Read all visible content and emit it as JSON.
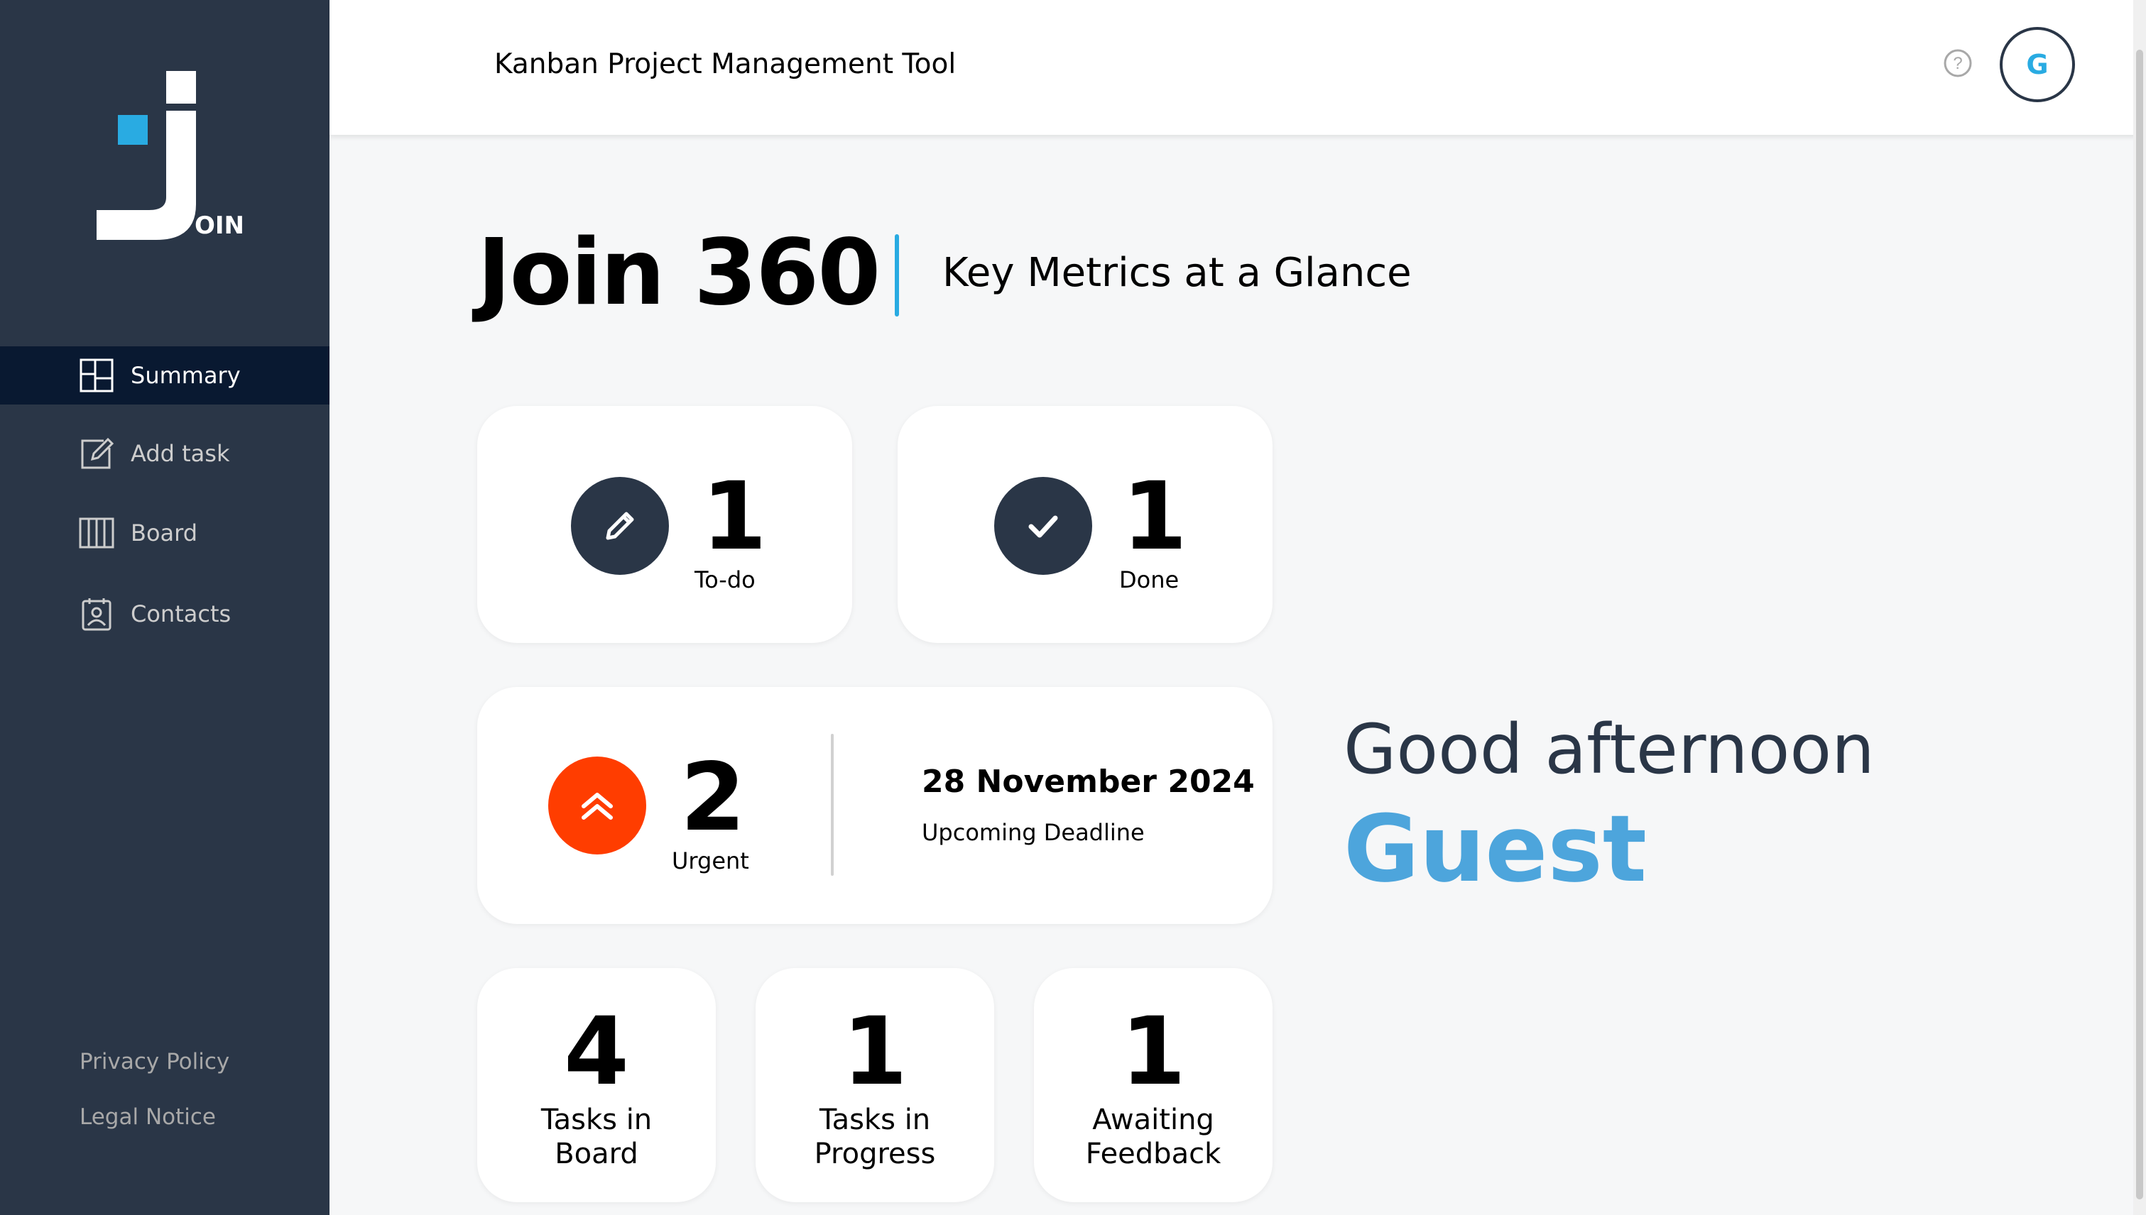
{
  "brand": {
    "logo_text": "OIN"
  },
  "sidebar": {
    "items": [
      {
        "label": "Summary",
        "icon": "summary-icon",
        "active": true
      },
      {
        "label": "Add task",
        "icon": "add-task-icon",
        "active": false
      },
      {
        "label": "Board",
        "icon": "board-icon",
        "active": false
      },
      {
        "label": "Contacts",
        "icon": "contacts-icon",
        "active": false
      }
    ],
    "footer": {
      "privacy": "Privacy Policy",
      "legal": "Legal Notice"
    }
  },
  "header": {
    "title": "Kanban Project Management Tool",
    "help_icon": "help-icon",
    "avatar_initial": "G"
  },
  "page": {
    "title": "Join 360",
    "subtitle": "Key Metrics at a Glance"
  },
  "metrics": {
    "todo": {
      "count": "1",
      "label": "To-do",
      "icon": "pencil-icon"
    },
    "done": {
      "count": "1",
      "label": "Done",
      "icon": "check-icon"
    },
    "urgent": {
      "count": "2",
      "label": "Urgent",
      "icon": "double-chevron-up-icon"
    },
    "deadline": {
      "date": "28 November 2024",
      "label": "Upcoming Deadline"
    },
    "tasks_in_board": {
      "count": "4",
      "label_line1": "Tasks in",
      "label_line2": "Board"
    },
    "tasks_in_progress": {
      "count": "1",
      "label_line1": "Tasks in",
      "label_line2": "Progress"
    },
    "awaiting_feedback": {
      "count": "1",
      "label_line1": "Awaiting",
      "label_line2": "Feedback"
    }
  },
  "greeting": {
    "text": "Good afternoon",
    "name": "Guest"
  },
  "colors": {
    "sidebar_bg": "#2a3647",
    "sidebar_active_bg": "#091931",
    "accent": "#29abe2",
    "urgent": "#ff3d00",
    "guest_name": "#4da5dc"
  }
}
